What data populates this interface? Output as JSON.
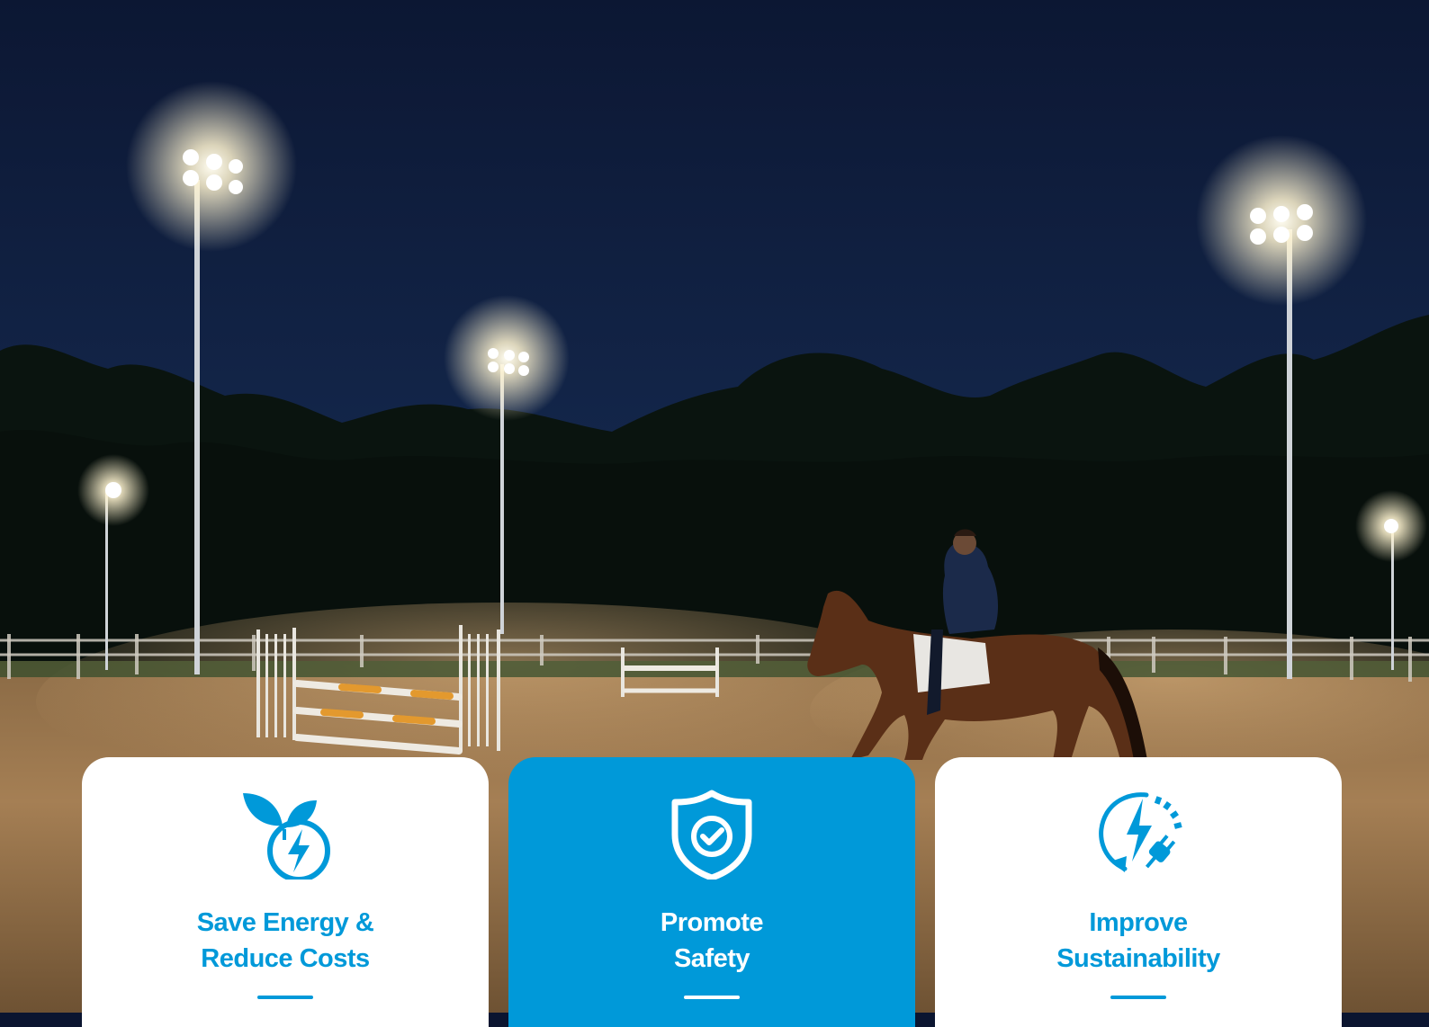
{
  "colors": {
    "accent": "#0099d9",
    "card_background": "#ffffff",
    "sky": "#0b1530"
  },
  "cards": [
    {
      "title_line1": "Save Energy &",
      "title_line2": "Reduce Costs",
      "icon": "leaf-energy-icon",
      "highlighted": false
    },
    {
      "title_line1": "Promote",
      "title_line2": "Safety",
      "icon": "shield-check-icon",
      "highlighted": true
    },
    {
      "title_line1": "Improve",
      "title_line2": "Sustainability",
      "icon": "recycle-energy-plug-icon",
      "highlighted": false
    }
  ]
}
